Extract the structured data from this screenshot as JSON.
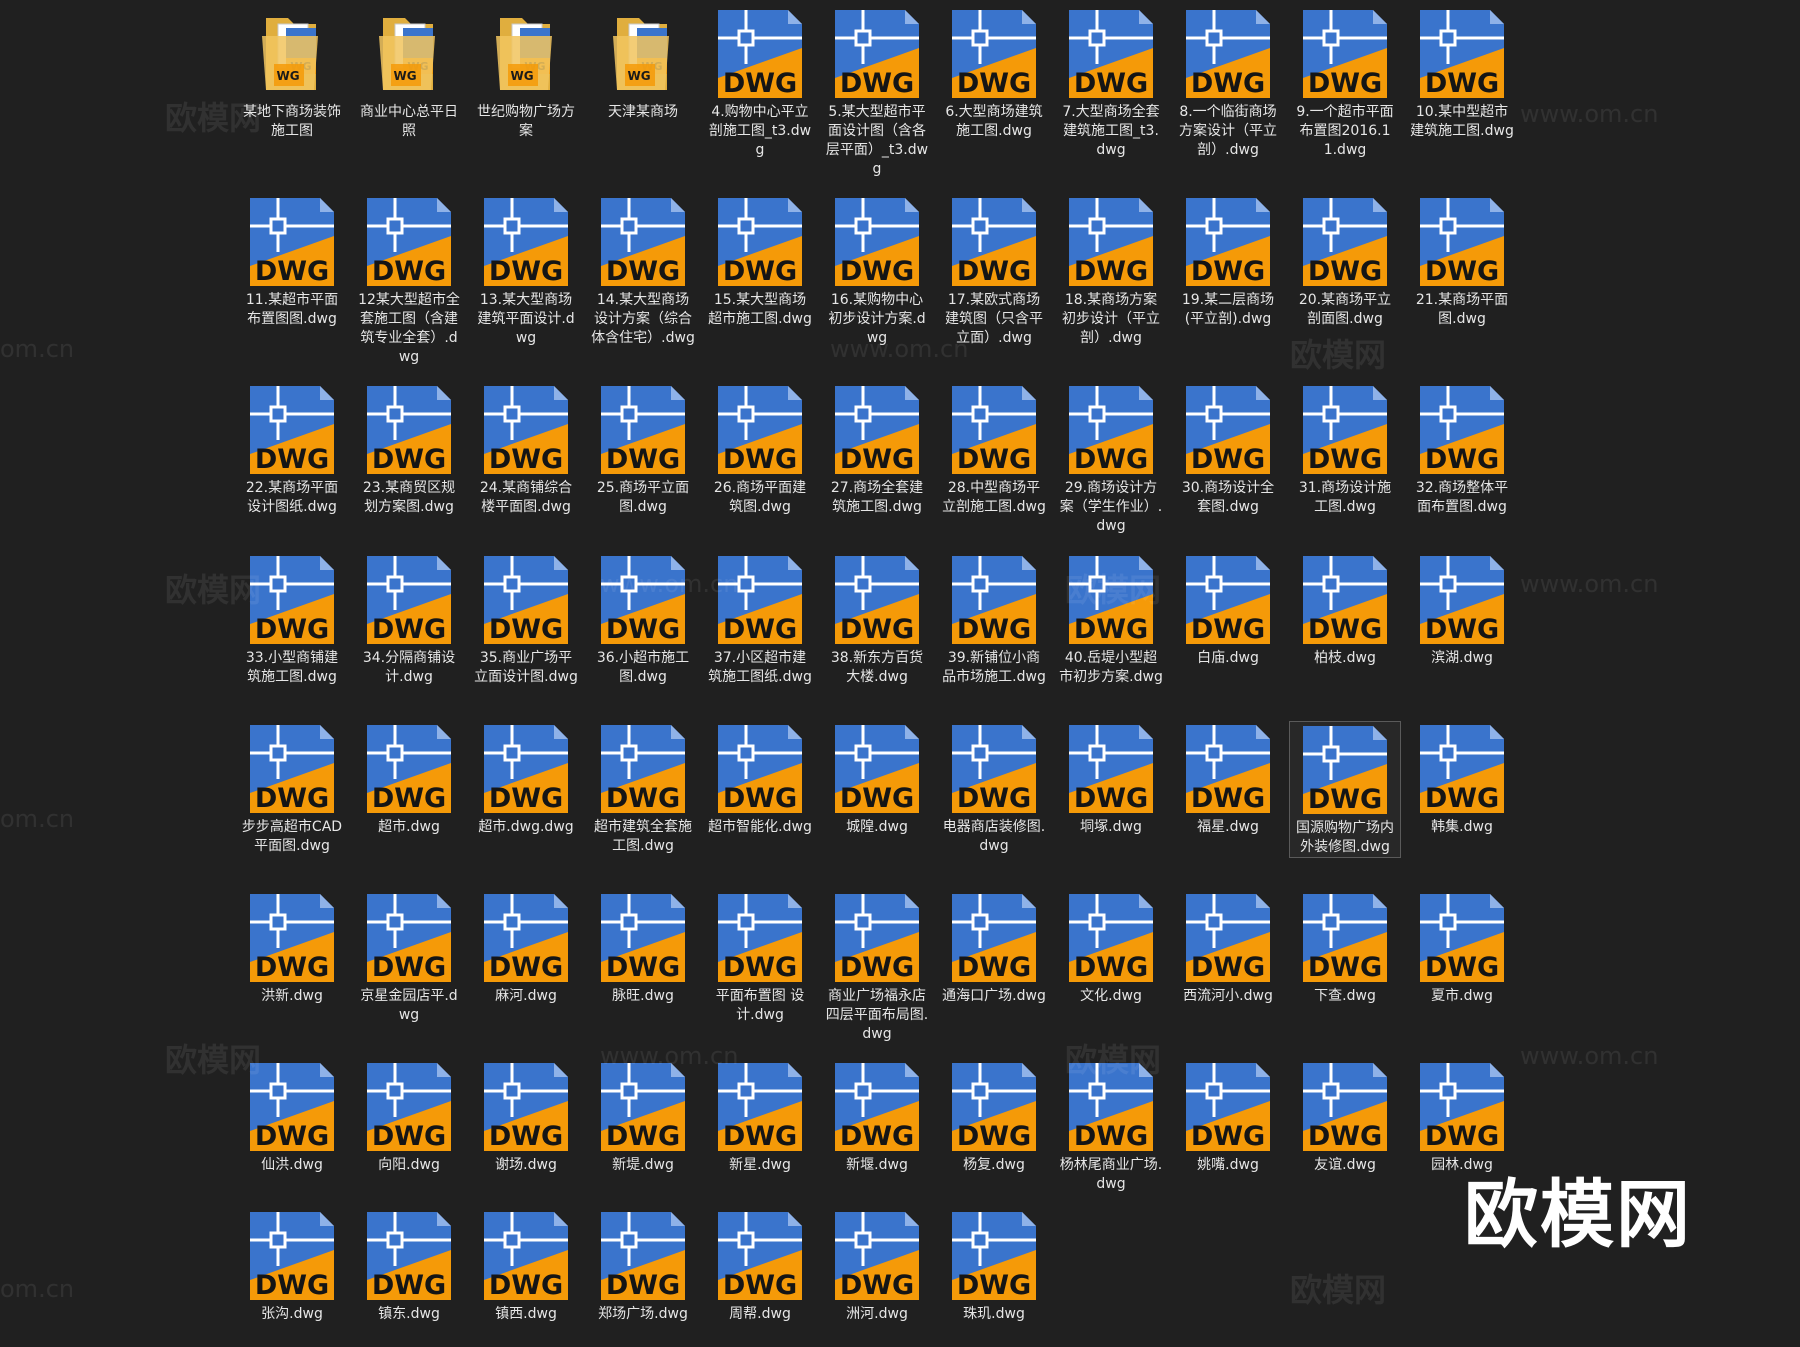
{
  "icons": {
    "folder": "folder-icon",
    "file": "dwg-file-icon"
  },
  "colors": {
    "background": "#202020",
    "dwg_blue": "#3a74cc",
    "dwg_orange": "#f59a08",
    "folder_yellow": "#f1c55f"
  },
  "brand": "欧模网",
  "watermarks": [
    "欧模网",
    "www.om.cn",
    "om.cn"
  ],
  "rows": [
    [
      {
        "label": "某地下商场装饰施工图",
        "type": "folder"
      },
      {
        "label": "商业中心总平日照",
        "type": "folder"
      },
      {
        "label": "世纪购物广场方案",
        "type": "folder"
      },
      {
        "label": "天津某商场",
        "type": "folder"
      },
      {
        "label": "4.购物中心平立剖施工图_t3.dwg",
        "type": "file"
      },
      {
        "label": "5.某大型超市平面设计图（含各层平面）_t3.dwg",
        "type": "file"
      },
      {
        "label": "6.大型商场建筑施工图.dwg",
        "type": "file"
      },
      {
        "label": "7.大型商场全套建筑施工图_t3.dwg",
        "type": "file"
      },
      {
        "label": "8.一个临街商场方案设计（平立剖）.dwg",
        "type": "file"
      },
      {
        "label": "9.一个超市平面布置图2016.11.dwg",
        "type": "file"
      },
      {
        "label": "10.某中型超市建筑施工图.dwg",
        "type": "file"
      }
    ],
    [
      {
        "label": "11.某超市平面布置图图.dwg",
        "type": "file"
      },
      {
        "label": "12某大型超市全套施工图（含建筑专业全套）.dwg",
        "type": "file"
      },
      {
        "label": "13.某大型商场建筑平面设计.dwg",
        "type": "file"
      },
      {
        "label": "14.某大型商场设计方案（综合体含住宅）.dwg",
        "type": "file"
      },
      {
        "label": "15.某大型商场超市施工图.dwg",
        "type": "file"
      },
      {
        "label": "16.某购物中心初步设计方案.dwg",
        "type": "file"
      },
      {
        "label": "17.某欧式商场建筑图（只含平立面）.dwg",
        "type": "file"
      },
      {
        "label": "18.某商场方案初步设计（平立剖）.dwg",
        "type": "file"
      },
      {
        "label": "19.某二层商场(平立剖).dwg",
        "type": "file"
      },
      {
        "label": "20.某商场平立剖面图.dwg",
        "type": "file"
      },
      {
        "label": "21.某商场平面图.dwg",
        "type": "file"
      }
    ],
    [
      {
        "label": "22.某商场平面设计图纸.dwg",
        "type": "file"
      },
      {
        "label": "23.某商贸区规划方案图.dwg",
        "type": "file"
      },
      {
        "label": "24.某商铺综合楼平面图.dwg",
        "type": "file"
      },
      {
        "label": "25.商场平立面图.dwg",
        "type": "file"
      },
      {
        "label": "26.商场平面建筑图.dwg",
        "type": "file"
      },
      {
        "label": "27.商场全套建筑施工图.dwg",
        "type": "file"
      },
      {
        "label": "28.中型商场平立剖施工图.dwg",
        "type": "file"
      },
      {
        "label": "29.商场设计方案（学生作业）.dwg",
        "type": "file"
      },
      {
        "label": "30.商场设计全套图.dwg",
        "type": "file"
      },
      {
        "label": "31.商场设计施工图.dwg",
        "type": "file"
      },
      {
        "label": "32.商场整体平面布置图.dwg",
        "type": "file"
      }
    ],
    [
      {
        "label": "33.小型商铺建筑施工图.dwg",
        "type": "file"
      },
      {
        "label": "34.分隔商铺设计.dwg",
        "type": "file"
      },
      {
        "label": "35.商业广场平立面设计图.dwg",
        "type": "file"
      },
      {
        "label": "36.小超市施工图.dwg",
        "type": "file"
      },
      {
        "label": "37.小区超市建筑施工图纸.dwg",
        "type": "file"
      },
      {
        "label": "38.新东方百货大楼.dwg",
        "type": "file"
      },
      {
        "label": "39.新铺位小商品市场施工.dwg",
        "type": "file"
      },
      {
        "label": "40.岳堤小型超市初步方案.dwg",
        "type": "file"
      },
      {
        "label": "白庙.dwg",
        "type": "file"
      },
      {
        "label": "柏枝.dwg",
        "type": "file"
      },
      {
        "label": "滨湖.dwg",
        "type": "file"
      }
    ],
    [
      {
        "label": "步步高超市CAD平面图.dwg",
        "type": "file"
      },
      {
        "label": "超市.dwg",
        "type": "file"
      },
      {
        "label": "超市.dwg.dwg",
        "type": "file"
      },
      {
        "label": "超市建筑全套施工图.dwg",
        "type": "file"
      },
      {
        "label": "超市智能化.dwg",
        "type": "file"
      },
      {
        "label": "城隍.dwg",
        "type": "file"
      },
      {
        "label": "电器商店装修图.dwg",
        "type": "file"
      },
      {
        "label": "垌塚.dwg",
        "type": "file"
      },
      {
        "label": "福星.dwg",
        "type": "file"
      },
      {
        "label": "国源购物广场内外装修图.dwg",
        "type": "file",
        "selected": true
      },
      {
        "label": "韩集.dwg",
        "type": "file"
      }
    ],
    [
      {
        "label": "洪新.dwg",
        "type": "file"
      },
      {
        "label": "京星金园店平.dwg",
        "type": "file"
      },
      {
        "label": "麻河.dwg",
        "type": "file"
      },
      {
        "label": "脉旺.dwg",
        "type": "file"
      },
      {
        "label": "平面布置图 设计.dwg",
        "type": "file"
      },
      {
        "label": "商业广场福永店四层平面布局图.dwg",
        "type": "file"
      },
      {
        "label": "通海口广场.dwg",
        "type": "file"
      },
      {
        "label": "文化.dwg",
        "type": "file"
      },
      {
        "label": "西流河小.dwg",
        "type": "file"
      },
      {
        "label": "下查.dwg",
        "type": "file"
      },
      {
        "label": "夏市.dwg",
        "type": "file"
      }
    ],
    [
      {
        "label": "仙洪.dwg",
        "type": "file"
      },
      {
        "label": "向阳.dwg",
        "type": "file"
      },
      {
        "label": "谢场.dwg",
        "type": "file"
      },
      {
        "label": "新堤.dwg",
        "type": "file"
      },
      {
        "label": "新星.dwg",
        "type": "file"
      },
      {
        "label": "新堰.dwg",
        "type": "file"
      },
      {
        "label": "杨复.dwg",
        "type": "file"
      },
      {
        "label": "杨林尾商业广场.dwg",
        "type": "file"
      },
      {
        "label": "姚嘴.dwg",
        "type": "file"
      },
      {
        "label": "友谊.dwg",
        "type": "file"
      },
      {
        "label": "园林.dwg",
        "type": "file"
      }
    ],
    [
      {
        "label": "张沟.dwg",
        "type": "file"
      },
      {
        "label": "镇东.dwg",
        "type": "file"
      },
      {
        "label": "镇西.dwg",
        "type": "file"
      },
      {
        "label": "郑场广场.dwg",
        "type": "file"
      },
      {
        "label": "周帮.dwg",
        "type": "file"
      },
      {
        "label": "洲河.dwg",
        "type": "file"
      },
      {
        "label": "珠玑.dwg",
        "type": "file"
      }
    ]
  ]
}
